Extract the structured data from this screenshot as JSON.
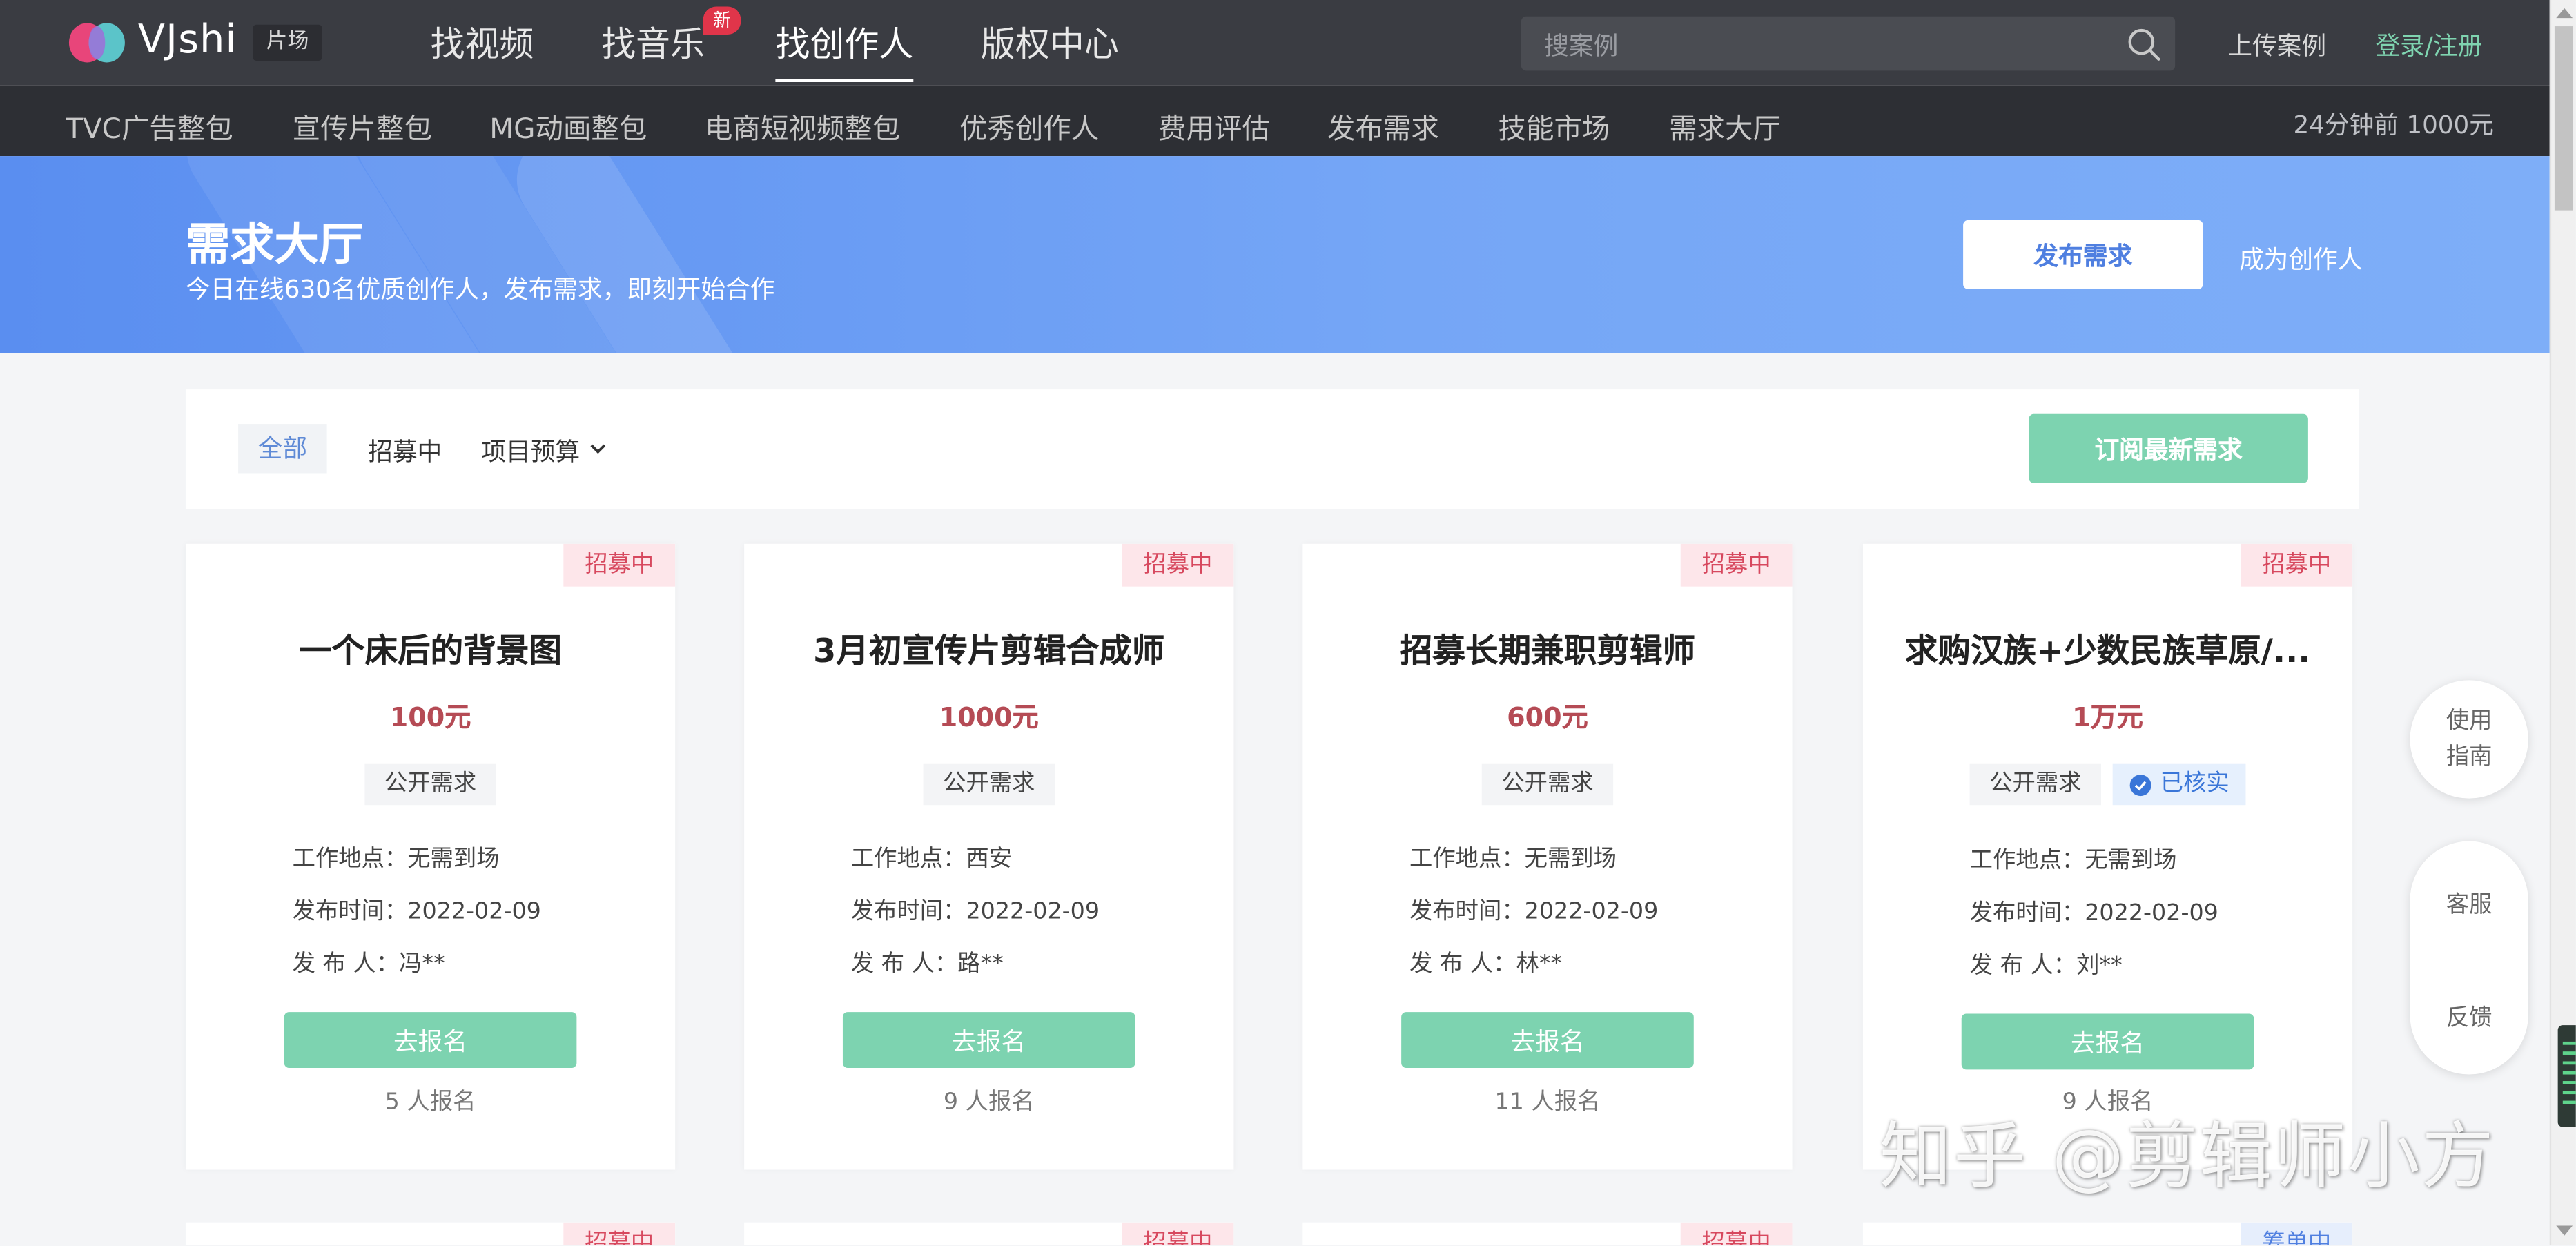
{
  "header": {
    "brand": "VJshi",
    "brand_tag": "片场",
    "nav": [
      "找视频",
      "找音乐",
      "找创作人",
      "版权中心"
    ],
    "new_badge": "新",
    "search_placeholder": "搜案例",
    "upload": "上传案例",
    "login": "登录/注册"
  },
  "subnav": {
    "items": [
      "TVC广告整包",
      "宣传片整包",
      "MG动画整包",
      "电商短视频整包",
      "优秀创作人",
      "费用评估",
      "发布需求",
      "技能市场",
      "需求大厅"
    ],
    "ticker": "24分钟前  1000元"
  },
  "banner": {
    "title": "需求大厅",
    "subtitle": "今日在线630名优质创作人，发布需求，即刻开始合作",
    "publish_label": "发布需求",
    "become_label": "成为创作人"
  },
  "filter": {
    "all": "全部",
    "recruiting": "招募中",
    "budget": "项目预算",
    "subscribe": "订阅最新需求"
  },
  "cards": [
    {
      "status": "招募中",
      "title": "一个床后的背景图",
      "price": "100元",
      "tag": "公开需求",
      "verified": "",
      "location": "工作地点：无需到场",
      "date": "发布时间：2022-02-09",
      "publisher": "发  布 人：冯**",
      "button": "去报名",
      "count": "5 人报名"
    },
    {
      "status": "招募中",
      "title": "3月初宣传片剪辑合成师",
      "price": "1000元",
      "tag": "公开需求",
      "verified": "",
      "location": "工作地点：西安",
      "date": "发布时间：2022-02-09",
      "publisher": "发  布 人：路**",
      "button": "去报名",
      "count": "9 人报名"
    },
    {
      "status": "招募中",
      "title": "招募长期兼职剪辑师",
      "price": "600元",
      "tag": "公开需求",
      "verified": "",
      "location": "工作地点：无需到场",
      "date": "发布时间：2022-02-09",
      "publisher": "发  布 人：林**",
      "button": "去报名",
      "count": "11 人报名"
    },
    {
      "status": "招募中",
      "title": "求购汉族+少数民族草原/...",
      "price": "1万元",
      "tag": "公开需求",
      "verified": "已核实",
      "location": "工作地点：无需到场",
      "date": "发布时间：2022-02-09",
      "publisher": "发  布 人：刘**",
      "button": "去报名",
      "count": "9 人报名"
    }
  ],
  "row2_status": [
    "招募中",
    "招募中",
    "招募中",
    "筹单中"
  ],
  "side": {
    "guide_line1": "使用",
    "guide_line2": "指南",
    "service": "客服",
    "feedback": "反馈"
  },
  "watermark": "知乎 @剪辑师小方",
  "colors": {
    "topbar": "#3a3c42",
    "subbar": "#2d2f34",
    "accent_green": "#7dd3b0",
    "banner_blue": "#6a9cf4",
    "price_red": "#b54b55",
    "status_pink": "#d7485e"
  }
}
